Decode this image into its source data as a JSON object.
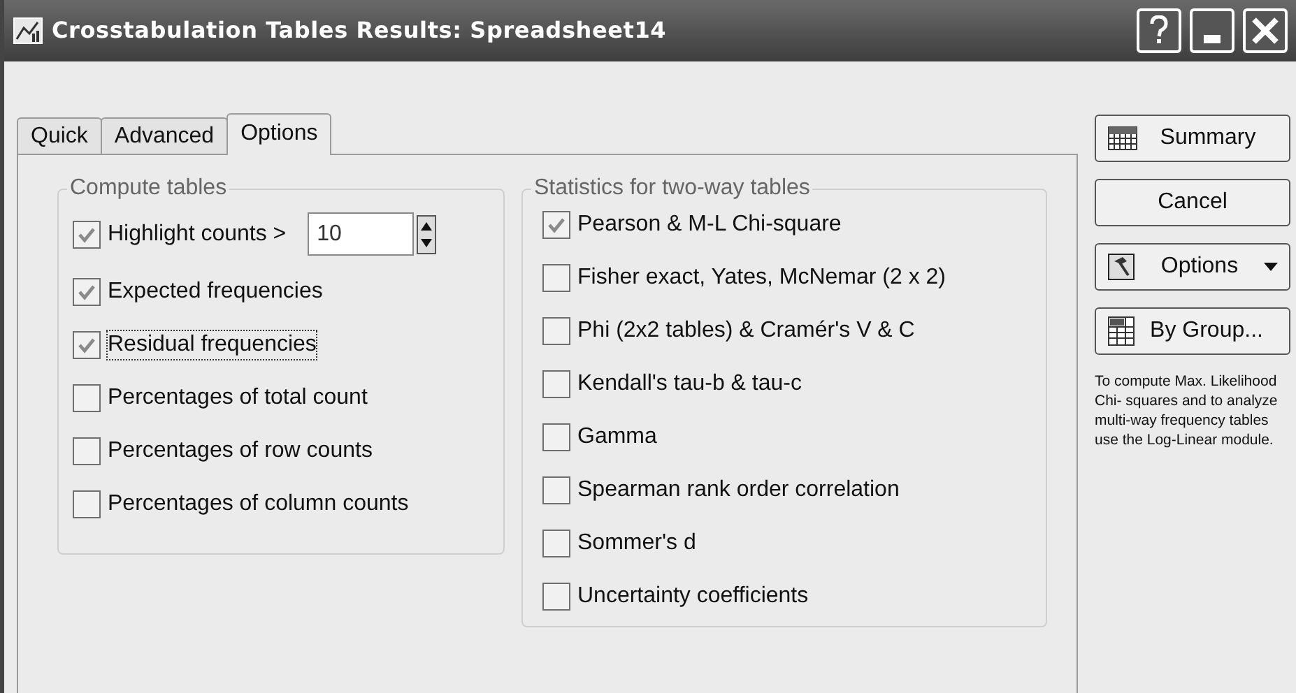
{
  "window": {
    "title": "Crosstabulation Tables Results: Spreadsheet14"
  },
  "tabs": [
    {
      "label": "Quick",
      "selected": false
    },
    {
      "label": "Advanced",
      "selected": false
    },
    {
      "label": "Options",
      "selected": true
    }
  ],
  "compute_tables": {
    "title": "Compute tables",
    "items": [
      {
        "label": "Highlight counts >",
        "checked": true,
        "focused": false,
        "spin_value": "10"
      },
      {
        "label": "Expected frequencies",
        "checked": true,
        "focused": false
      },
      {
        "label": "Residual frequencies",
        "checked": true,
        "focused": true
      },
      {
        "label": "Percentages of total count",
        "checked": false,
        "focused": false
      },
      {
        "label": "Percentages of row counts",
        "checked": false,
        "focused": false
      },
      {
        "label": "Percentages of column counts",
        "checked": false,
        "focused": false
      }
    ]
  },
  "two_way_statistics": {
    "title": "Statistics for two-way tables",
    "items": [
      {
        "label": "Pearson & M-L Chi-square",
        "checked": true
      },
      {
        "label": "Fisher exact, Yates, McNemar (2 x 2)",
        "checked": false
      },
      {
        "label": "Phi (2x2 tables) & Cramér's V &  C",
        "checked": false
      },
      {
        "label": "Kendall's tau-b & tau-c",
        "checked": false
      },
      {
        "label": "Gamma",
        "checked": false
      },
      {
        "label": "Spearman rank order correlation",
        "checked": false
      },
      {
        "label": "Sommer's d",
        "checked": false
      },
      {
        "label": "Uncertainty coefficients",
        "checked": false
      }
    ]
  },
  "buttons": [
    {
      "kind": "summary",
      "label": "Summary"
    },
    {
      "kind": "plain",
      "label": "Cancel"
    },
    {
      "kind": "options",
      "label": "Options"
    },
    {
      "kind": "bygroup",
      "label": "By Group..."
    }
  ],
  "note": "To compute Max. Likelihood Chi- squares and to analyze multi-way frequency tables use the Log-Linear module."
}
